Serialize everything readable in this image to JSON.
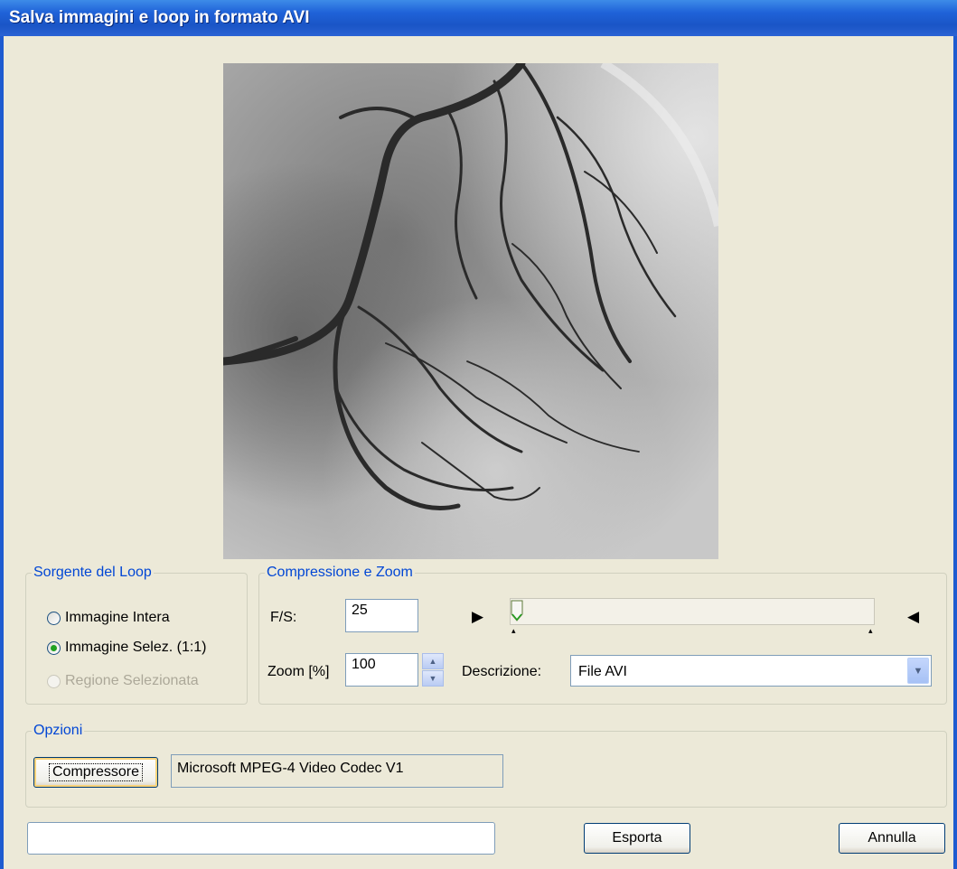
{
  "window": {
    "title": "Salva immagini e loop in formato AVI"
  },
  "source_group": {
    "legend": "Sorgente del Loop",
    "options": [
      {
        "label": "Immagine Intera",
        "checked": false,
        "enabled": true
      },
      {
        "label": "Immagine Selez. (1:1)",
        "checked": true,
        "enabled": true
      },
      {
        "label": "Regione Selezionata",
        "checked": false,
        "enabled": false
      }
    ]
  },
  "compression_group": {
    "legend": "Compressione e Zoom",
    "fps_label": "F/S:",
    "fps_value": "25",
    "zoom_label": "Zoom [%]",
    "zoom_value": "100",
    "description_label": "Descrizione:",
    "description_value": "File AVI",
    "frame_slider_position": 0
  },
  "options_group": {
    "legend": "Opzioni",
    "compressor_button": "Compressore",
    "codec_name": "Microsoft MPEG-4 Video Codec V1"
  },
  "footer": {
    "filename_value": "",
    "export_button": "Esporta",
    "cancel_button": "Annulla"
  },
  "colors": {
    "title_bar": "#1F62D8",
    "legend_text": "#0046D5",
    "dialog_bg": "#ECE9D8"
  }
}
